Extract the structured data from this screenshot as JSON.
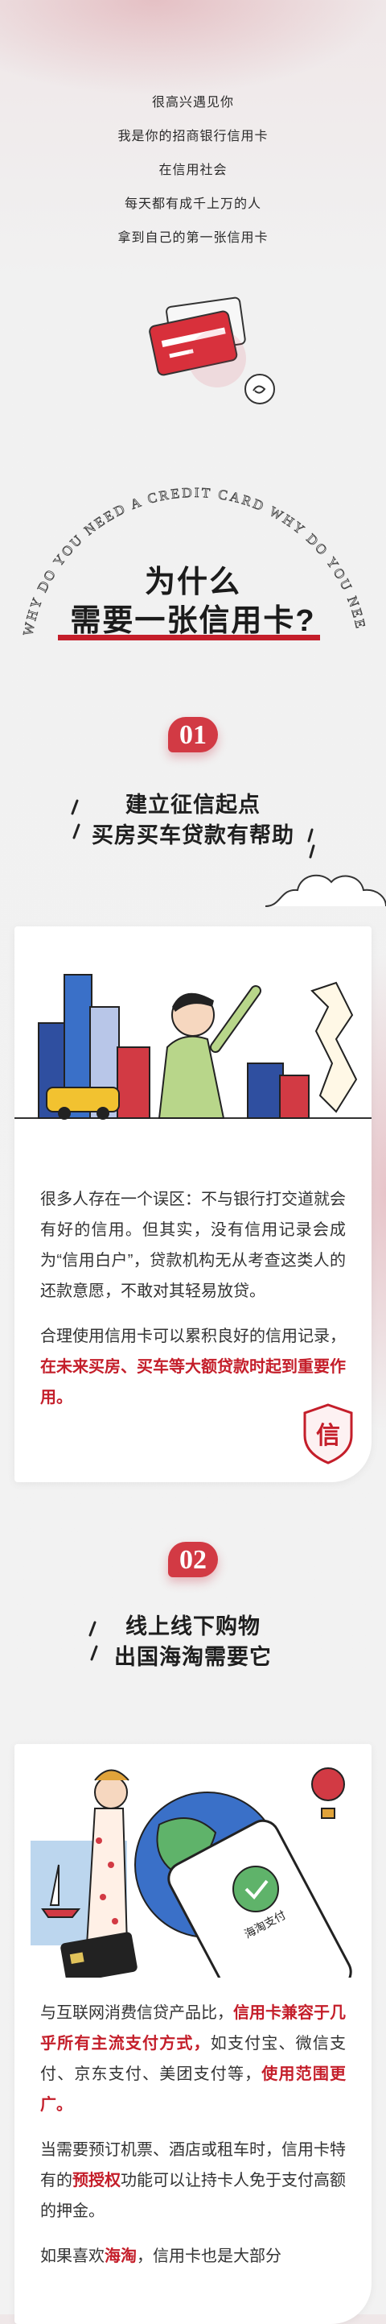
{
  "intro": {
    "lines": [
      "很高兴遇见你",
      "我是你的招商银行信用卡",
      "在信用社会",
      "每天都有成千上万的人",
      "拿到自己的第一张信用卡"
    ]
  },
  "arc_text": "WHY DO YOU NEED A CREDIT CARD WHY DO YOU NEED A",
  "main_title": {
    "line1": "为什么",
    "line2": "需要一张信用卡?"
  },
  "section1": {
    "number": "01",
    "title_line1": "建立征信起点",
    "title_line2": "买房买车贷款有帮助",
    "para1": "很多人存在一个误区：不与银行打交道就会有好的信用。但其实，没有信用记录会成为“信用白户”，贷款机构无从考查这类人的还款意愿，不敢对其轻易放贷。",
    "para2_plain": "合理使用信用卡可以累积良好的信用记录，",
    "para2_red": "在未来买房、买车等大额贷款时起到重要作用。",
    "seal_char": "信"
  },
  "section2": {
    "number": "02",
    "title_line1": "线上线下购物",
    "title_line2": "出国海淘需要它",
    "phone_text": "海淘支付",
    "para1_plain_a": "与互联网消费信贷产品比，",
    "para1_red_a": "信用卡兼容于几乎所有主流支付方式，",
    "para1_plain_b": "如支付宝、微信支付、京东支付、美团支付等，",
    "para1_red_b": "使用范围更广。",
    "para2_plain_a": "当需要预订机票、酒店或租车时，信用卡特有的",
    "para2_red": "预授权",
    "para2_plain_b": "功能可以让持卡人免于支付高额的押金。",
    "para3_plain_a": "如果喜欢",
    "para3_red": "海淘",
    "para3_plain_b": "，信用卡也是大部分"
  },
  "colors": {
    "accent": "#c41e2a",
    "badge": "#d23a44"
  }
}
